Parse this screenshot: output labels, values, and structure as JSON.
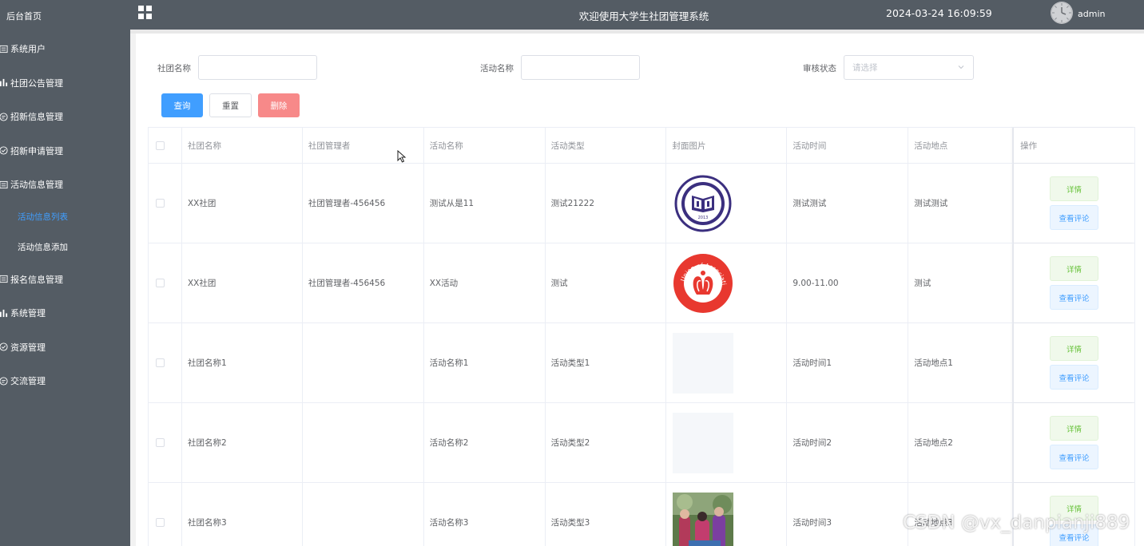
{
  "sidebar": {
    "home": "后台首页",
    "items": [
      {
        "label": "系统用户",
        "icon": "list-icon"
      },
      {
        "label": "社团公告管理",
        "icon": "bar-chart-icon"
      },
      {
        "label": "招新信息管理",
        "icon": "chat-icon"
      },
      {
        "label": "招新申请管理",
        "icon": "check-circle-icon"
      },
      {
        "label": "活动信息管理",
        "icon": "list-icon"
      }
    ],
    "sub_items": [
      {
        "label": "活动信息列表",
        "active": true
      },
      {
        "label": "活动信息添加",
        "active": false
      }
    ],
    "items_after": [
      {
        "label": "报名信息管理",
        "icon": "list-icon"
      },
      {
        "label": "系统管理",
        "icon": "bar-chart-icon"
      },
      {
        "label": "资源管理",
        "icon": "check-circle-icon"
      },
      {
        "label": "交流管理",
        "icon": "chat-icon"
      }
    ]
  },
  "topbar": {
    "title": "欢迎使用大学生社团管理系统",
    "datetime": "2024-03-24 16:09:59",
    "username": "admin"
  },
  "search": {
    "club_label": "社团名称",
    "club_value": "",
    "activity_label": "活动名称",
    "activity_value": "",
    "status_label": "审核状态",
    "status_placeholder": "请选择",
    "query_btn": "查询",
    "reset_btn": "重置",
    "delete_btn": "删除"
  },
  "table": {
    "headers": [
      "社团名称",
      "社团管理者",
      "活动名称",
      "活动类型",
      "封面图片",
      "活动时间",
      "活动地点",
      "操作"
    ],
    "rows": [
      {
        "club": "XX社团",
        "manager": "社团管理者-456456",
        "name": "测试从是11",
        "type": "测试21222",
        "cover": "blue-emblem",
        "time": "测试测试",
        "place": "测试测试"
      },
      {
        "club": "XX社团",
        "manager": "社团管理者-456456",
        "name": "XX活动",
        "type": "测试",
        "cover": "red-emblem",
        "time": "9.00-11.00",
        "place": "测试"
      },
      {
        "club": "社团名称1",
        "manager": "",
        "name": "活动名称1",
        "type": "活动类型1",
        "cover": "empty",
        "time": "活动时间1",
        "place": "活动地点1"
      },
      {
        "club": "社团名称2",
        "manager": "",
        "name": "活动名称2",
        "type": "活动类型2",
        "cover": "empty",
        "time": "活动时间2",
        "place": "活动地点2"
      },
      {
        "club": "社团名称3",
        "manager": "",
        "name": "活动名称3",
        "type": "活动类型3",
        "cover": "photo",
        "time": "活动时间3",
        "place": "活动地点3"
      }
    ],
    "detail_btn": "详情",
    "comment_btn": "查看评论"
  },
  "watermark": "CSDN @vx_danpianji889",
  "emblem_texts": {
    "blue_year": "2013",
    "red_ring": "Union of Association"
  },
  "colors": {
    "sidebar_bg": "#545c64",
    "primary": "#409eff",
    "danger": "#f78989",
    "success": "#67c23a"
  }
}
